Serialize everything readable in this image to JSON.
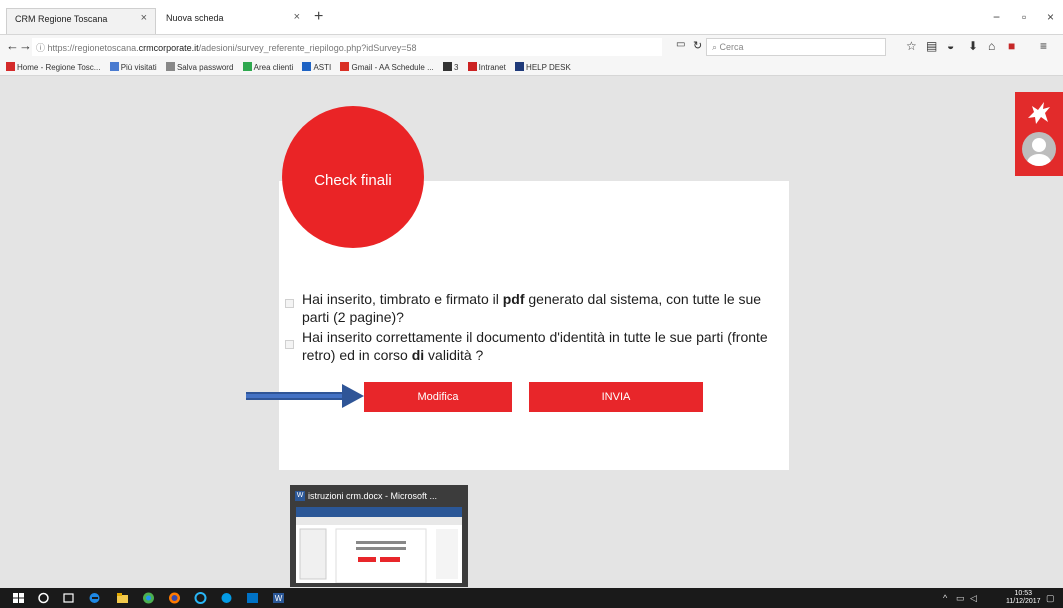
{
  "browser": {
    "tabs": [
      {
        "label": "CRM Regione Toscana",
        "close": "×"
      },
      {
        "label": "Nuova scheda",
        "close": "×"
      }
    ],
    "new_tab": "+",
    "window_controls": [
      "−",
      "▫",
      "×"
    ],
    "url_prefix": "https://regionetoscana.",
    "url_host": "crmcorporate.it",
    "url_path": "/adesioni/survey_referente_riepilogo.php?idSurvey=58",
    "search_placeholder": "Cerca",
    "bookmarks": [
      {
        "label": "Home - Regione Tosc...",
        "color": "#d42a2a"
      },
      {
        "label": "Più visitati",
        "color": "#4a7bd0"
      },
      {
        "label": "Salva password",
        "color": "#888888"
      },
      {
        "label": "Area clienti",
        "color": "#2fa84f"
      },
      {
        "label": "ASTI",
        "color": "#1e63c4"
      },
      {
        "label": "Gmail - AA Schedule ...",
        "color": "#d93025"
      },
      {
        "label": "3",
        "color": "#333333"
      },
      {
        "label": "Intranet",
        "color": "#cc2222"
      },
      {
        "label": "HELP DESK",
        "color": "#1f3a7a"
      }
    ]
  },
  "page": {
    "circle_title": "Check finali",
    "questions": [
      {
        "pre": "Hai inserito, timbrato e firmato il ",
        "bold": "pdf",
        "post": " generato dal sistema, con tutte le sue parti (2 pagine)?"
      },
      {
        "pre": "Hai inserito correttamente il documento d'identità in tutte le sue parti (fronte retro) ed in corso ",
        "bold": "di",
        "post": " validità ?"
      }
    ],
    "modifica_label": "Modifica",
    "invia_label": "INVIA",
    "accent": "#e8262a"
  },
  "taskbar": {
    "thumbnail_title": "istruzioni crm.docx - Microsoft ...",
    "time": "10:53",
    "date": "11/12/2017"
  }
}
